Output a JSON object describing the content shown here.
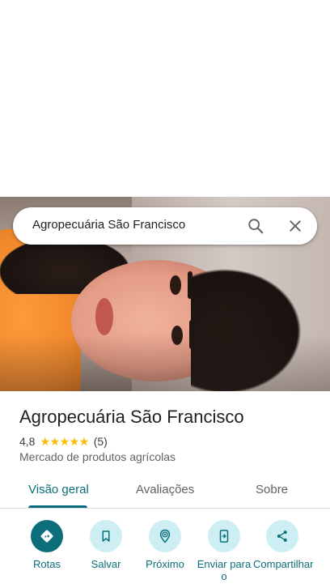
{
  "search": {
    "query": "Agropecuária São Francisco",
    "search_icon": "search-icon",
    "close_icon": "close-icon"
  },
  "place": {
    "name": "Agropecuária São Francisco",
    "rating": "4,8",
    "stars": "★★★★★",
    "review_count": "(5)",
    "category": "Mercado de produtos agrícolas"
  },
  "tabs": [
    {
      "label": "Visão geral",
      "active": true
    },
    {
      "label": "Avaliações",
      "active": false
    },
    {
      "label": "Sobre",
      "active": false
    }
  ],
  "actions": [
    {
      "label": "Rotas",
      "icon": "directions-icon"
    },
    {
      "label": "Salvar",
      "icon": "bookmark-icon"
    },
    {
      "label": "Próximo",
      "icon": "nearby-icon"
    },
    {
      "label": "Enviar para o",
      "icon": "send-to-phone-icon"
    },
    {
      "label": "Compartilhar",
      "icon": "share-icon"
    }
  ],
  "colors": {
    "accent": "#0b6e7a",
    "action_bg": "#cdeff4",
    "star": "#fbbc04"
  }
}
